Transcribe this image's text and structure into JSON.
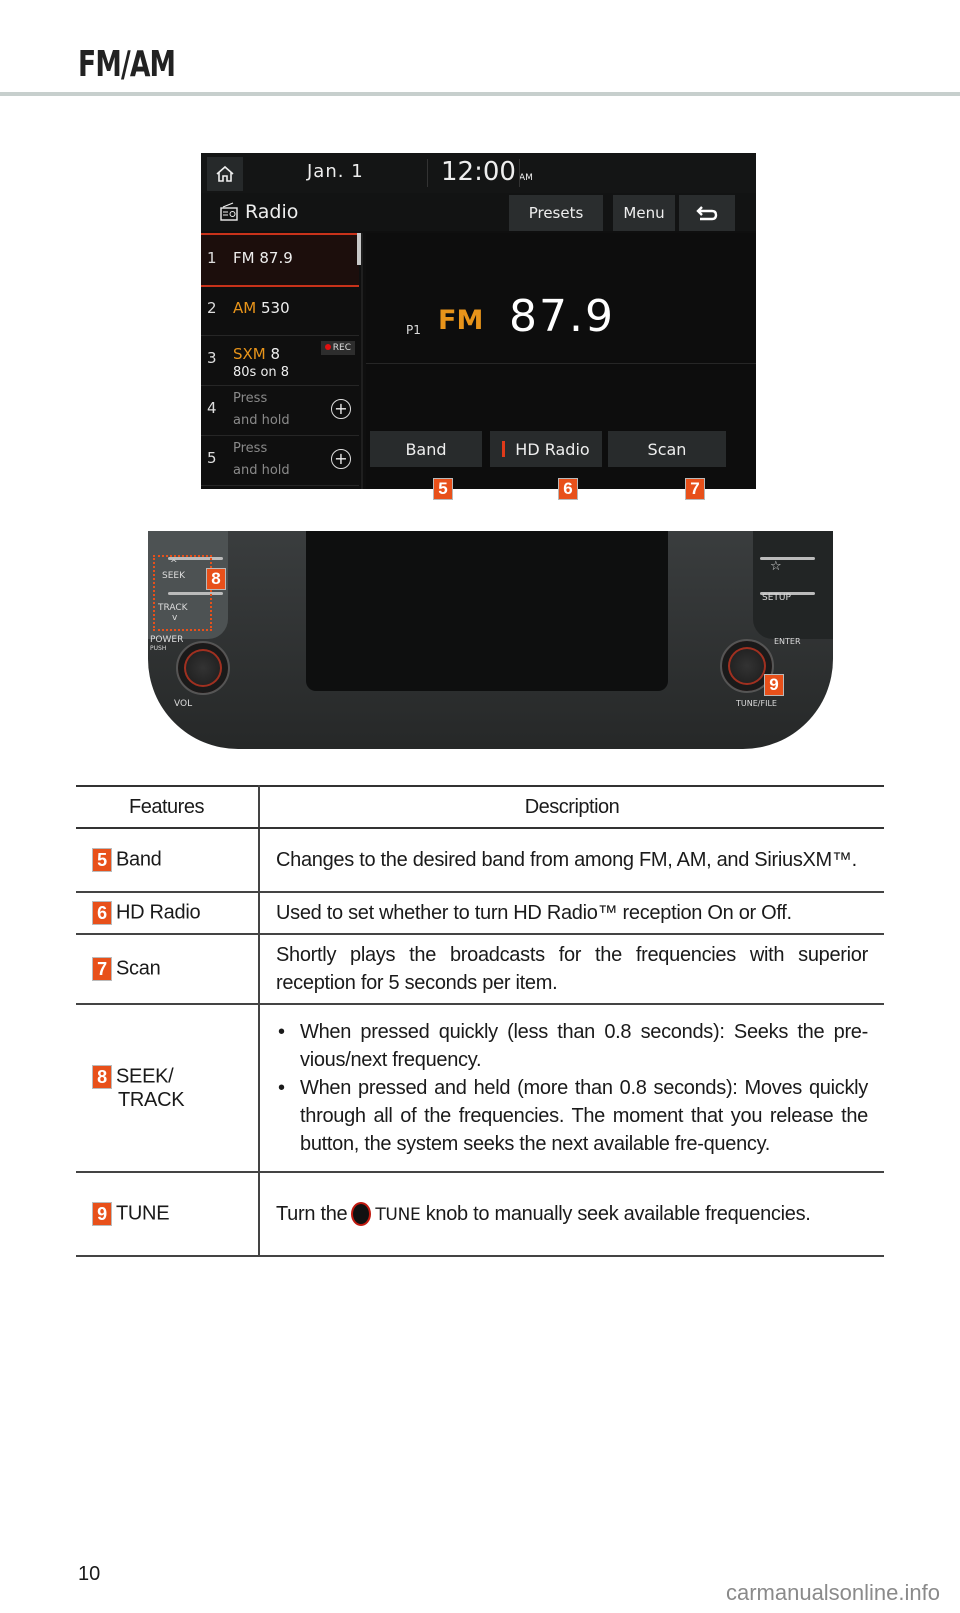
{
  "page": {
    "title": "FM/AM",
    "page_number": "10",
    "watermark": "carmanualsonline.info"
  },
  "screen": {
    "date": "Jan.  1",
    "time": "12:00",
    "ampm": "AM",
    "app_title": "Radio",
    "header_buttons": {
      "presets": "Presets",
      "menu": "Menu",
      "back_icon": "back-arrow-icon"
    },
    "presets": [
      {
        "num": "1",
        "band": "FM",
        "value": "87.9",
        "active": true
      },
      {
        "num": "2",
        "band": "AM",
        "value": "530"
      },
      {
        "num": "3",
        "band": "SXM",
        "value": "8",
        "subtitle": "80s on 8",
        "badge": "REC"
      },
      {
        "num": "4",
        "line1": "Press",
        "line2": "and hold"
      },
      {
        "num": "5",
        "line1": "Press",
        "line2": "and hold"
      }
    ],
    "now_playing": {
      "preset": "P1",
      "band": "FM",
      "frequency": "87.9"
    },
    "bottom_buttons": {
      "band": "Band",
      "hd_radio": "HD Radio",
      "scan": "Scan"
    },
    "callouts": [
      "5",
      "6",
      "7"
    ]
  },
  "head_unit": {
    "labels": {
      "seek": "SEEK",
      "track": "TRACK",
      "power": "POWER",
      "push": "PUSH",
      "vol": "VOL",
      "setup": "SETUP",
      "enter": "ENTER",
      "tune_file": "TUNE/FILE"
    },
    "callouts": [
      "8",
      "9"
    ]
  },
  "table": {
    "headers": [
      "Features",
      "Description"
    ],
    "rows": [
      {
        "num": "5",
        "feature": "Band",
        "description": "Changes to the desired band from among FM, AM, and SiriusXM™."
      },
      {
        "num": "6",
        "feature": "HD Radio",
        "description": "Used to set whether to turn HD Radio™ reception On or Off."
      },
      {
        "num": "7",
        "feature": "Scan",
        "description": "Shortly plays the broadcasts for the frequencies with superior reception for 5 seconds per item."
      },
      {
        "num": "8",
        "feature": "SEEK/",
        "feature_line2": "TRACK",
        "bullets": [
          "When pressed quickly (less than 0.8 seconds): Seeks the pre-vious/next frequency.",
          "When pressed and held (more than 0.8 seconds): Moves quickly through all of the frequencies. The moment that you release the button, the system seeks the next available fre-quency."
        ]
      },
      {
        "num": "9",
        "feature": "TUNE",
        "desc_before": "Turn the",
        "desc_knob": "TUNE",
        "desc_after": "knob to manually seek available frequencies."
      }
    ]
  },
  "colors": {
    "accent_orange": "#e8941a",
    "callout": "#e8501a",
    "active_red": "#c8321a"
  }
}
